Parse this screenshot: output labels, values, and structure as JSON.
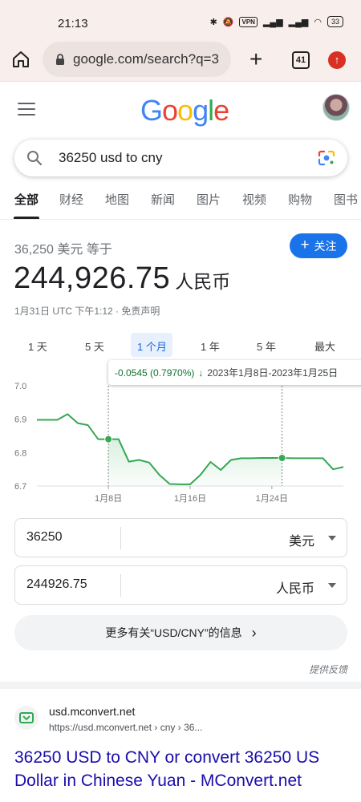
{
  "status_bar": {
    "time": "21:13",
    "vpn": "VPN",
    "battery": "33"
  },
  "browser": {
    "url": "google.com/search?q=3",
    "tab_count": "41"
  },
  "search": {
    "query": "36250 usd to cny"
  },
  "tabs": [
    "全部",
    "财经",
    "地图",
    "新闻",
    "图片",
    "视频",
    "购物",
    "图书"
  ],
  "converter": {
    "equals_line": "36,250 美元 等于",
    "follow_label": "关注",
    "result_value": "244,926.75",
    "result_unit": "人民币",
    "date_line": "1月31日 UTC 下午1:12 · 免责声明",
    "ranges": [
      "1 天",
      "5 天",
      "1 个月",
      "1 年",
      "5 年",
      "最大"
    ],
    "active_range": "1 个月",
    "tooltip": {
      "change": "-0.0545 (0.7970%)",
      "range": "2023年1月8日-2023年1月25日"
    },
    "from_amount": "36250",
    "from_currency": "美元",
    "to_amount": "244926.75",
    "to_currency": "人民币",
    "more_info": "更多有关“USD/CNY”的信息",
    "feedback": "提供反馈"
  },
  "chart_data": {
    "type": "area",
    "y_ticks": [
      "7.0",
      "6.9",
      "6.8",
      "6.7"
    ],
    "x_ticks": [
      "1月8日",
      "1月16日",
      "1月24日"
    ],
    "ylim": [
      6.7,
      7.0
    ],
    "color": "#34a853",
    "x": [
      1,
      2,
      3,
      4,
      5,
      6,
      7,
      8,
      9,
      10,
      11,
      12,
      13,
      14,
      15,
      16,
      17,
      18,
      19,
      20,
      21,
      22,
      23,
      24,
      25,
      26,
      27,
      28,
      29,
      30,
      31
    ],
    "values": [
      6.898,
      6.898,
      6.898,
      6.915,
      6.888,
      6.882,
      6.84,
      6.84,
      6.84,
      6.773,
      6.778,
      6.77,
      6.733,
      6.706,
      6.705,
      6.705,
      6.733,
      6.772,
      6.748,
      6.778,
      6.783,
      6.783,
      6.784,
      6.784,
      6.784,
      6.783,
      6.783,
      6.783,
      6.783,
      6.75,
      6.757
    ],
    "markers": [
      {
        "x": 8,
        "y": 6.84
      },
      {
        "x": 25,
        "y": 6.784
      }
    ]
  },
  "result": {
    "site": "usd.mconvert.net",
    "breadcrumb": "https://usd.mconvert.net › cny › 36...",
    "title": "36250 USD to CNY or convert 36250 US Dollar in Chinese Yuan - MConvert.net"
  }
}
